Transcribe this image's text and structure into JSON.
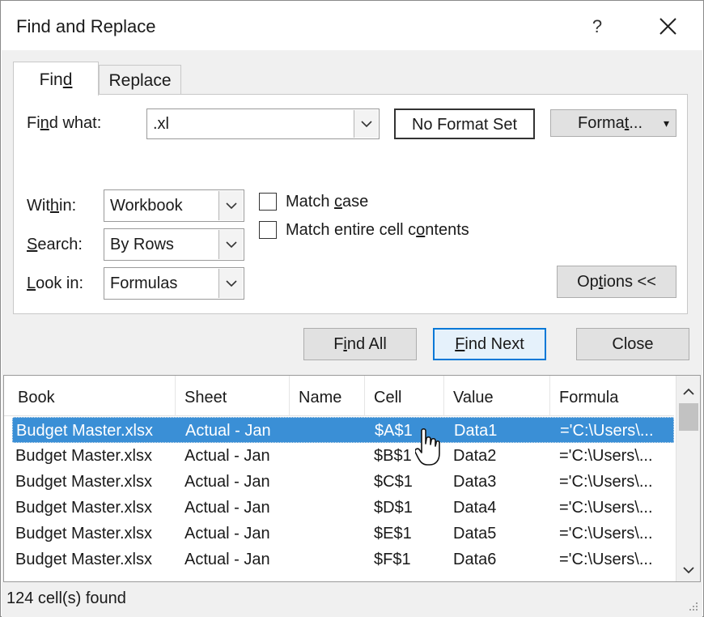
{
  "window": {
    "title": "Find and Replace",
    "help_label": "?"
  },
  "tabs": [
    {
      "label": "Find",
      "underline": "d",
      "pre": "Fin",
      "post": ""
    },
    {
      "label": "Replace",
      "pre": "Replace"
    }
  ],
  "find_what": {
    "label_pre": "Fi",
    "label_u": "n",
    "label_post": "d what:",
    "value": ".xl"
  },
  "format_preview": "No Format Set",
  "format_button": {
    "pre": "Forma",
    "u": "t",
    "post": "...",
    "arrow": "▾"
  },
  "within": {
    "label_pre": "Wit",
    "label_u": "h",
    "label_post": "in:",
    "value": "Workbook"
  },
  "search": {
    "label_pre": "",
    "label_u": "S",
    "label_post": "earch:",
    "value": "By Rows"
  },
  "look_in": {
    "label_pre": "",
    "label_u": "L",
    "label_post": "ook in:",
    "value": "Formulas"
  },
  "match_case": {
    "pre": "Match ",
    "u": "c",
    "post": "ase",
    "checked": false
  },
  "match_entire": {
    "pre": "Match entire cell c",
    "u": "o",
    "post": "ntents",
    "checked": false
  },
  "options_button": {
    "pre": "Op",
    "u": "t",
    "post": "ions <<"
  },
  "buttons": {
    "find_all": {
      "pre": "F",
      "u": "i",
      "post": "nd All"
    },
    "find_next": {
      "pre": "",
      "u": "F",
      "post": "ind Next"
    },
    "close": "Close"
  },
  "results": {
    "columns": [
      "Book",
      "Sheet",
      "Name",
      "Cell",
      "Value",
      "Formula"
    ],
    "rows": [
      [
        "Budget Master.xlsx",
        "Actual - Jan",
        "",
        "$A$1",
        "Data1",
        "='C:\\Users\\..."
      ],
      [
        "Budget Master.xlsx",
        "Actual - Jan",
        "",
        "$B$1",
        "Data2",
        "='C:\\Users\\..."
      ],
      [
        "Budget Master.xlsx",
        "Actual - Jan",
        "",
        "$C$1",
        "Data3",
        "='C:\\Users\\..."
      ],
      [
        "Budget Master.xlsx",
        "Actual - Jan",
        "",
        "$D$1",
        "Data4",
        "='C:\\Users\\..."
      ],
      [
        "Budget Master.xlsx",
        "Actual - Jan",
        "",
        "$E$1",
        "Data5",
        "='C:\\Users\\..."
      ],
      [
        "Budget Master.xlsx",
        "Actual - Jan",
        "",
        "$F$1",
        "Data6",
        "='C:\\Users\\..."
      ]
    ],
    "selected_row": 0
  },
  "status": "124 cell(s) found",
  "colors": {
    "accent": "#0078d7",
    "selection": "#3a8fd6"
  }
}
